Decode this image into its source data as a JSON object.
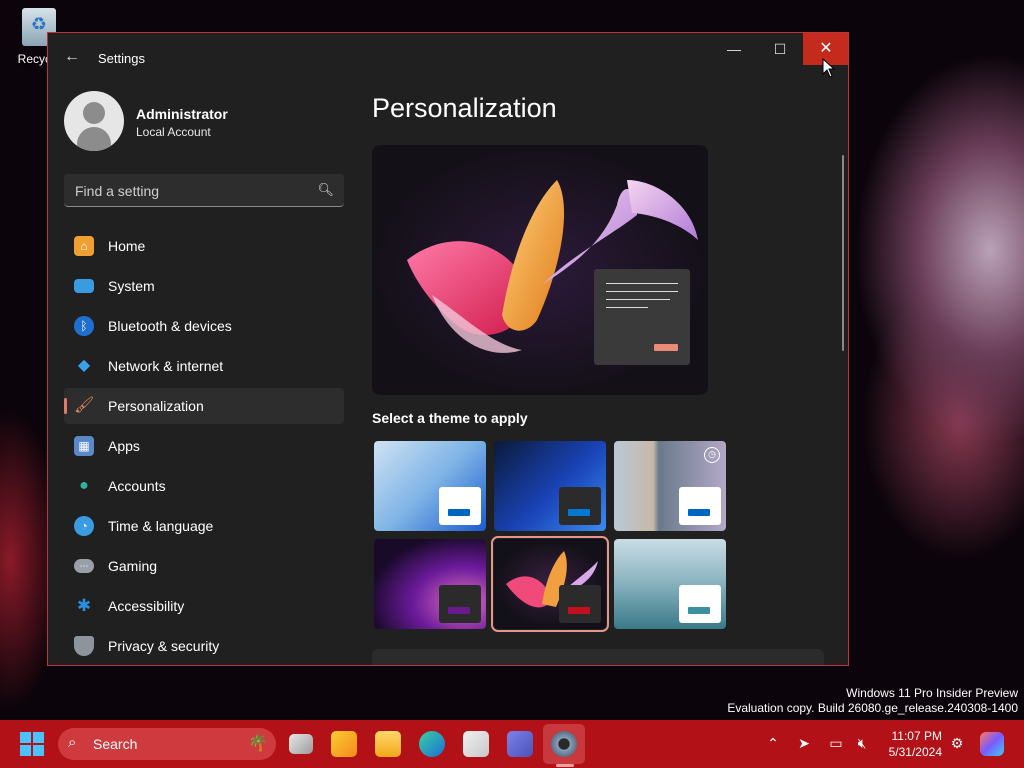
{
  "desktop": {
    "recycle_bin_label": "Recycle",
    "watermark_line1": "Windows 11 Pro Insider Preview",
    "watermark_line2": "Evaluation copy. Build 26080.ge_release.240308-1400"
  },
  "window": {
    "title": "Settings",
    "minimize_icon": "minimize-icon",
    "maximize_icon": "maximize-icon",
    "close_icon": "close-icon"
  },
  "profile": {
    "name": "Administrator",
    "account_type": "Local Account"
  },
  "search": {
    "placeholder": "Find a setting"
  },
  "nav": {
    "items": [
      {
        "label": "Home",
        "icon": "home-icon",
        "color": "#f0a030"
      },
      {
        "label": "System",
        "icon": "system-icon",
        "color": "#3a9be0"
      },
      {
        "label": "Bluetooth & devices",
        "icon": "bluetooth-icon",
        "color": "#1f6fd1"
      },
      {
        "label": "Network & internet",
        "icon": "wifi-icon",
        "color": "#3aa0e8"
      },
      {
        "label": "Personalization",
        "icon": "brush-icon",
        "color": "#e0895a"
      },
      {
        "label": "Apps",
        "icon": "apps-icon",
        "color": "#5a88c8"
      },
      {
        "label": "Accounts",
        "icon": "accounts-icon",
        "color": "#2fb3a0"
      },
      {
        "label": "Time & language",
        "icon": "globe-icon",
        "color": "#3a9be0"
      },
      {
        "label": "Gaming",
        "icon": "gamepad-icon",
        "color": "#9aa0a8"
      },
      {
        "label": "Accessibility",
        "icon": "accessibility-icon",
        "color": "#2b8fe0"
      },
      {
        "label": "Privacy & security",
        "icon": "shield-icon",
        "color": "#8d949c"
      }
    ],
    "active_index": 4
  },
  "main": {
    "title": "Personalization",
    "theme_section_label": "Select a theme to apply",
    "themes": [
      {
        "name": "windows-light",
        "bg": "linear-gradient(135deg,#cfe3f3,#7fb4e6 50%,#1a5bd0)",
        "card": "#ffffff",
        "accent": "#0067c0",
        "selected": false
      },
      {
        "name": "windows-dark",
        "bg": "linear-gradient(135deg,#0a1a3a,#1a44b8 55%,#3a8cf0)",
        "card": "#2b2b2b",
        "accent": "#0078d4",
        "selected": false
      },
      {
        "name": "glow",
        "bg": "linear-gradient(90deg,#b9c9d6,#c8b8a8 35%,#6a7a8a 40%,#b3a8c8)",
        "card": "#ffffff",
        "accent": "#0067c0",
        "selected": false,
        "badge": "slideshow-icon"
      },
      {
        "name": "captured-motion",
        "bg": "radial-gradient(ellipse at 80% 70%,#e070c0,#6a1a9a 40%,#1a0a2a 75%)",
        "card": "#2b2b2b",
        "accent": "#6a1a8a",
        "selected": false
      },
      {
        "name": "flow",
        "bg": "radial-gradient(ellipse at 50% 50%,#3a2040,#121018 70%)",
        "card": "#2b2b2b",
        "accent": "#c4101c",
        "selected": true
      },
      {
        "name": "sunrise",
        "bg": "linear-gradient(180deg,#c9dde6,#8fb6c3 45%,#3a7a88)",
        "card": "#ffffff",
        "accent": "#3a90a0",
        "selected": false
      }
    ]
  },
  "taskbar": {
    "search_label": "Search",
    "time": "11:07 PM",
    "date": "5/31/2024"
  }
}
